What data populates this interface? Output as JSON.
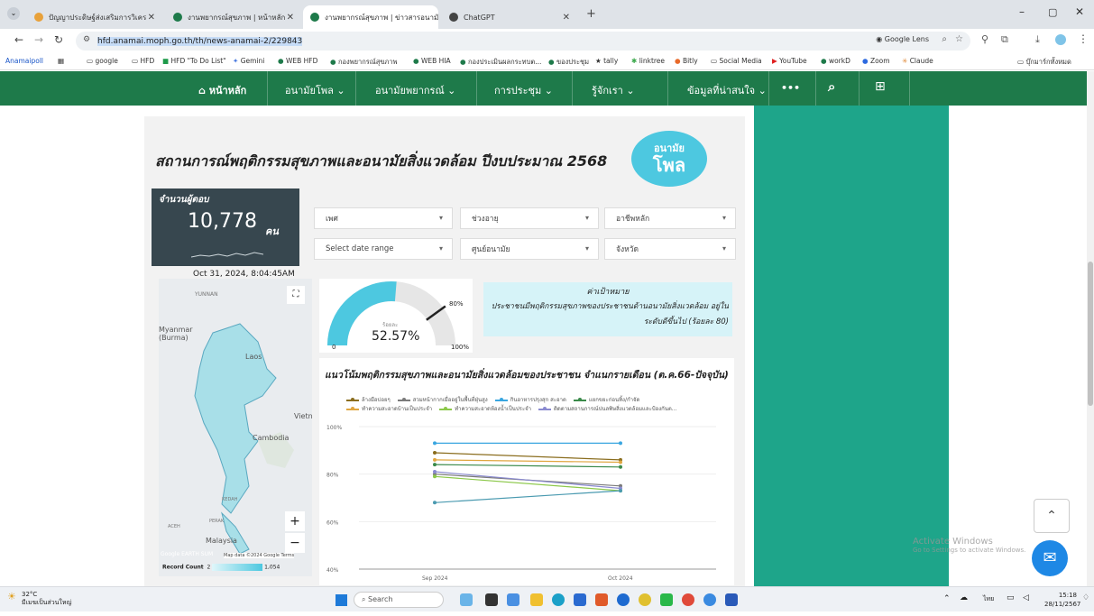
{
  "tabs": [
    {
      "label": "ปัญญาประดิษฐ์ส่งเสริมการวิเคร",
      "color": "#e8a13a"
    },
    {
      "label": "งานพยากรณ์สุขภาพ | หน้าหลัก",
      "color": "#1e7a4a"
    },
    {
      "label": "งานพยากรณ์สุขภาพ | ข่าวสารอนามั",
      "color": "#1e7a4a"
    },
    {
      "label": "ChatGPT",
      "color": "#444"
    }
  ],
  "tab_new": "+",
  "url": "hfd.anamai.moph.go.th/th/news-anamai-2/229843",
  "google_lens": "Google Lens",
  "bookmarks": [
    "Anamaipoll",
    "google",
    "HFD",
    "HFD \"To Do List\"",
    "Gemini",
    "WEB HFD",
    "กองพยากรณ์สุขภาพ",
    "WEB HIA",
    "กองประเมินผลกระทบต...",
    "ของประชุม",
    "tally",
    "linktree",
    "Bitly",
    "Social Media",
    "YouTube",
    "workD",
    "Zoom",
    "Claude"
  ],
  "bookmarks_right": "บุ๊กมาร์กทั้งหมด",
  "nav": {
    "home": "หน้าหลัก",
    "items": [
      "อนามัยโพล",
      "อนามัยพยากรณ์",
      "การประชุม",
      "รู้จักเรา",
      "ข้อมูลที่น่าสนใจ"
    ],
    "more": "•••"
  },
  "dashboard": {
    "title": "สถานการณ์พฤติกรรมสุขภาพและอนามัยสิ่งแวดล้อม ปีงบประมาณ 2568",
    "logo_top": "อนามัย",
    "logo_bottom": "โพล",
    "respondents_label": "จำนวนผู้ตอบ",
    "respondents_value": "10,778",
    "respondents_unit": "คน",
    "timestamp": "Oct 31, 2024, 8:04:45AM",
    "filters": [
      {
        "label": "เพศ"
      },
      {
        "label": "ช่วงอายุ"
      },
      {
        "label": "อาชีพหลัก"
      },
      {
        "label": "Select date range"
      },
      {
        "label": "ศูนย์อนามัย"
      },
      {
        "label": "จังหวัด"
      }
    ],
    "gauge": {
      "value_label": "52.57%",
      "value": 52.57,
      "min_label": "0",
      "max_label": "100%",
      "target_label": "80%",
      "target": 80,
      "sub_label": "ร้อยละ",
      "color": "#4dc8e0"
    },
    "target_box": {
      "title": "ค่าเป้าหมาย",
      "text": "ประชาชนมีพฤติกรรมสุขภาพของประชาชนด้านอนามัยสิ่งแวดล้อม อยู่ในระดับดีขึ้นไป (ร้อยละ 80)"
    },
    "map": {
      "labels": [
        "YUNNAN",
        "Myanmar (Burma)",
        "Laos",
        "Vietn",
        "Cambodia",
        "KEDAH",
        "PERAK",
        "ACEH",
        "Malaysia"
      ],
      "attrib": "Map data ©2024 Google  Terms",
      "google": "Google EARTH SUM",
      "record_label": "Record Count",
      "record_min": "2",
      "record_max": "1,054",
      "zoom_in": "+",
      "zoom_out": "−",
      "fullscreen": "⛶"
    }
  },
  "chart_data": {
    "type": "line",
    "title": "แนวโน้มพฤติกรรมสุขภาพและอนามัยสิ่งแวดล้อมของประชาชน จำแนกรายเดือน (ต.ค.66-ปัจจุบัน)",
    "categories": [
      "Sep 2024",
      "Oct 2024"
    ],
    "ylim": [
      40,
      100
    ],
    "yticks": [
      "40%",
      "60%",
      "80%",
      "100%"
    ],
    "series": [
      {
        "name": "ล้างมือบ่อยๆ",
        "color": "#8a6d1e",
        "values": [
          89,
          86
        ]
      },
      {
        "name": "สวมหน้ากากเมื่ออยู่ในพื้นที่ฝุ่นสูง",
        "color": "#7a7a7a",
        "values": [
          80,
          75
        ]
      },
      {
        "name": "กินอาหารปรุงสุก สะอาด",
        "color": "#39a6e0",
        "values": [
          93,
          93
        ]
      },
      {
        "name": "แยกขยะก่อนทิ้ง/กำจัด",
        "color": "#3a8a4a",
        "values": [
          84,
          83
        ]
      },
      {
        "name": "ทำความสะอาดบ้านเป็นประจำ",
        "color": "#e0a640",
        "values": [
          86,
          85
        ]
      },
      {
        "name": "ทำความสะอาดห้องน้ำเป็นประจำ",
        "color": "#8cc84a",
        "values": [
          79,
          73
        ]
      },
      {
        "name": "ติดตามสถานการณ์ปนลพิษสิ่งแวดล้อมและป้องกันต...",
        "color": "#8a8ad0",
        "values": [
          81,
          74
        ]
      },
      {
        "name": "",
        "color": "#4a9ab0",
        "values": [
          68,
          73
        ]
      }
    ]
  },
  "watermark": {
    "line1": "Activate Windows",
    "line2": "Go to Settings to activate Windows."
  },
  "taskbar": {
    "weather_temp": "32°C",
    "weather_text": "มีเมฆเป็นส่วนใหญ่",
    "search": "Search",
    "time": "15:18",
    "date": "28/11/2567",
    "lang": "ไทย"
  }
}
